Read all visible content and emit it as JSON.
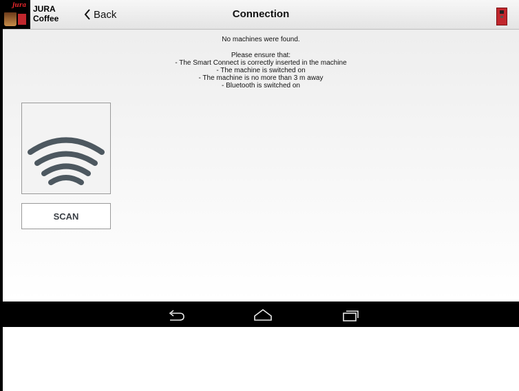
{
  "app": {
    "logo_text": "jura",
    "name_line1": "JURA",
    "name_line2": "Coffee"
  },
  "header": {
    "back_label": "Back",
    "title": "Connection"
  },
  "message": {
    "headline": "No machines were found.",
    "intro": "Please ensure that:",
    "items": [
      "- The Smart Connect is correctly inserted in the machine",
      "- The machine is switched on",
      "- The machine is no more than 3 m away",
      "- Bluetooth is switched on"
    ]
  },
  "scan": {
    "label": "SCAN"
  },
  "colors": {
    "accent": "#c1272d",
    "icon": "#4d5860",
    "navbar": "#000000"
  },
  "icons": {
    "back": "chevron-left-icon",
    "wifi": "wireless-signal-icon",
    "machine": "coffee-machine-icon",
    "nav_back": "nav-back-icon",
    "nav_home": "nav-home-icon",
    "nav_recents": "nav-recents-icon"
  }
}
